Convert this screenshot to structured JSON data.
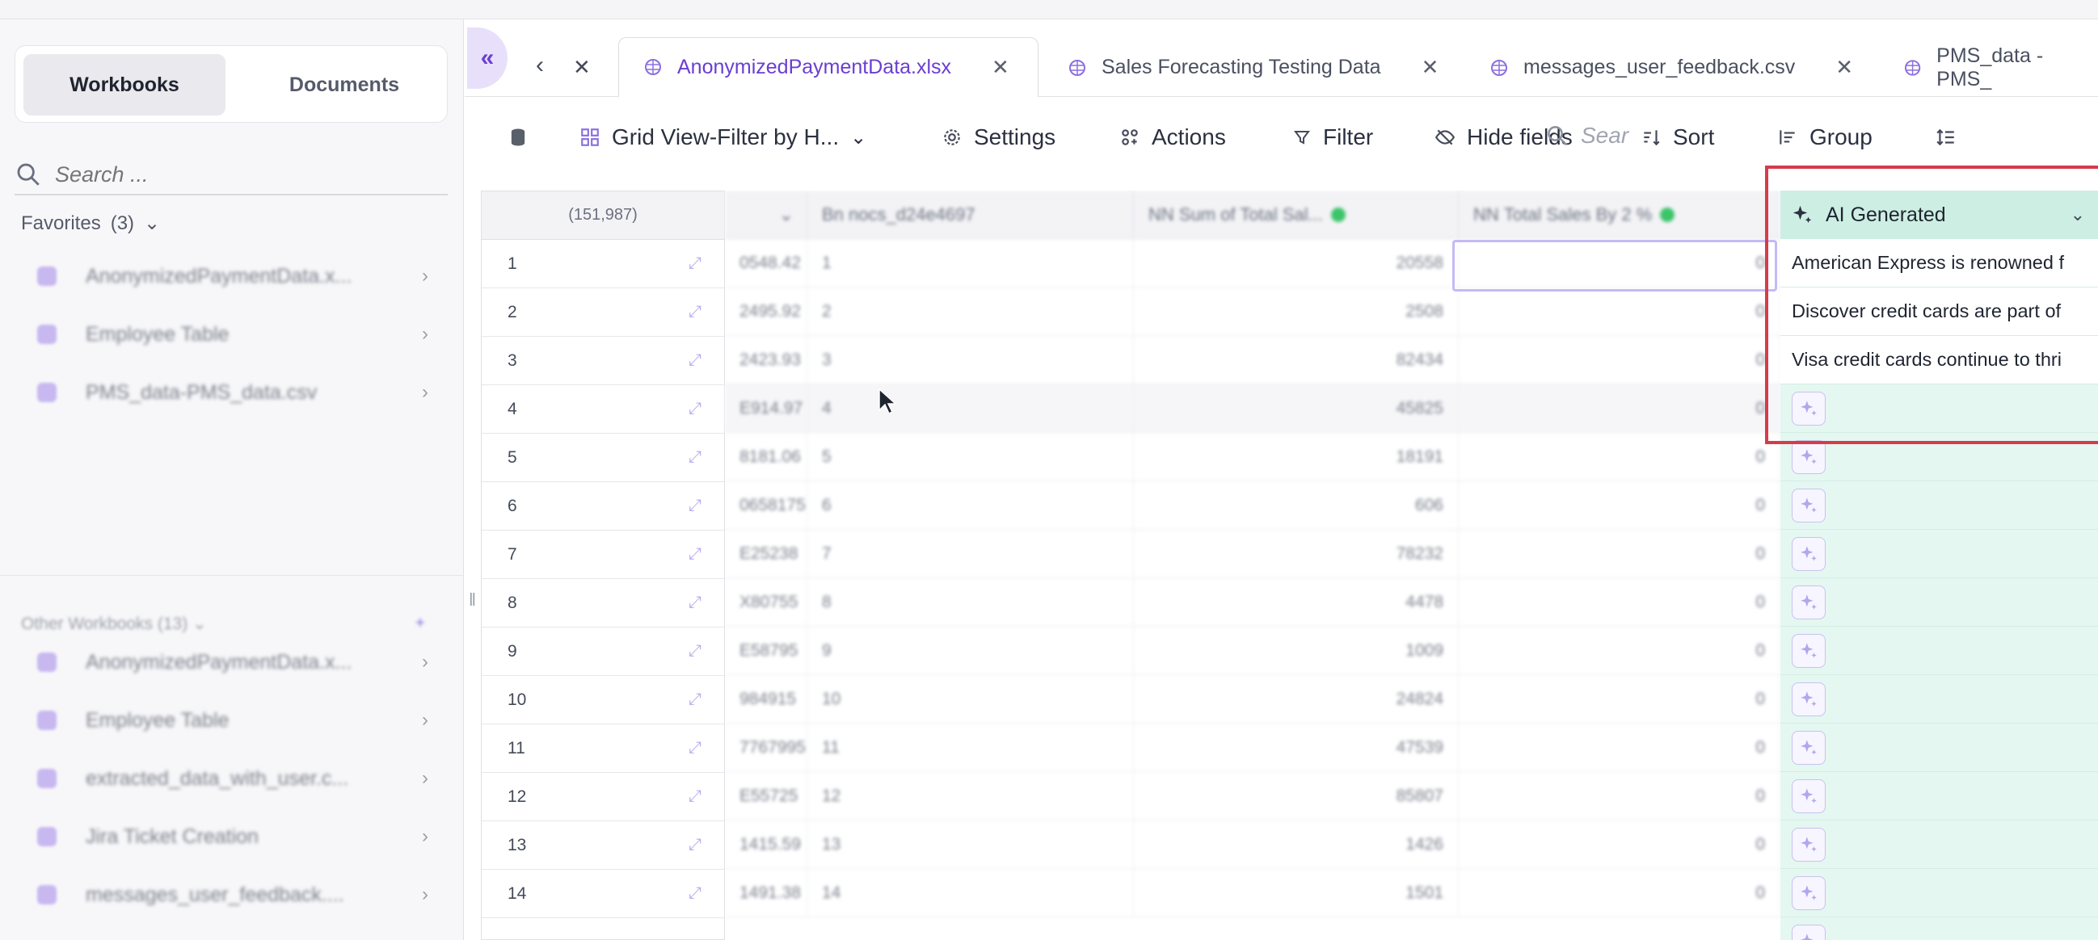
{
  "sidebar": {
    "tabs": {
      "workbooks": "Workbooks",
      "documents": "Documents"
    },
    "search_placeholder": "Search ...",
    "favorites_label": "Favorites",
    "favorites_count": "(3)",
    "favorites": [
      {
        "label": "AnonymizedPaymentData.x..."
      },
      {
        "label": "Employee Table"
      },
      {
        "label": "PMS_data-PMS_data.csv"
      }
    ],
    "other_label": "Other Workbooks",
    "other_count": "(13)",
    "others": [
      {
        "label": "AnonymizedPaymentData.x..."
      },
      {
        "label": "Employee Table"
      },
      {
        "label": "extracted_data_with_user.c..."
      },
      {
        "label": "Jira Ticket Creation"
      },
      {
        "label": "messages_user_feedback...."
      }
    ]
  },
  "tabs": [
    {
      "label": "AnonymizedPaymentData.xlsx",
      "active": true
    },
    {
      "label": "Sales Forecasting Testing Data",
      "active": false
    },
    {
      "label": "messages_user_feedback.csv",
      "active": false
    },
    {
      "label": "PMS_data - PMS_",
      "active": false
    }
  ],
  "toolbar": {
    "view_label": "Grid View-Filter by H...",
    "settings": "Settings",
    "actions": "Actions",
    "filter": "Filter",
    "hide_fields": "Hide fields",
    "sort": "Sort",
    "group": "Group",
    "search_placeholder": "Sear"
  },
  "grid": {
    "row_count": "(151,987)",
    "columns": [
      {
        "name": ""
      },
      {
        "name": "nocs_d24e4697"
      },
      {
        "name": "Sum of Total Sal..."
      },
      {
        "name": "Total Sales By 2 %"
      }
    ],
    "rows": [
      {
        "n": "1",
        "c0": "0548.42",
        "c1": "1",
        "c2": "20558",
        "c3": "0"
      },
      {
        "n": "2",
        "c0": "2495.92",
        "c1": "2",
        "c2": "2508",
        "c3": "0"
      },
      {
        "n": "3",
        "c0": "2423.93",
        "c1": "3",
        "c2": "82434",
        "c3": "0"
      },
      {
        "n": "4",
        "c0": "E914.97",
        "c1": "4",
        "c2": "45825",
        "c3": "0"
      },
      {
        "n": "5",
        "c0": "8181.06",
        "c1": "5",
        "c2": "18191",
        "c3": "0"
      },
      {
        "n": "6",
        "c0": "0658175",
        "c1": "6",
        "c2": "606",
        "c3": "0"
      },
      {
        "n": "7",
        "c0": "E25238",
        "c1": "7",
        "c2": "78232",
        "c3": "0"
      },
      {
        "n": "8",
        "c0": "X80755",
        "c1": "8",
        "c2": "4478",
        "c3": "0"
      },
      {
        "n": "9",
        "c0": "E58795",
        "c1": "9",
        "c2": "1009",
        "c3": "0"
      },
      {
        "n": "10",
        "c0": "984915",
        "c1": "10",
        "c2": "24824",
        "c3": "0"
      },
      {
        "n": "11",
        "c0": "7767995",
        "c1": "11",
        "c2": "47539",
        "c3": "0"
      },
      {
        "n": "12",
        "c0": "E55725",
        "c1": "12",
        "c2": "85807",
        "c3": "0"
      },
      {
        "n": "13",
        "c0": "1415.59",
        "c1": "13",
        "c2": "1426",
        "c3": "0"
      },
      {
        "n": "14",
        "c0": "1491.38",
        "c1": "14",
        "c2": "1501",
        "c3": "0"
      }
    ],
    "ai_column": {
      "title": "AI Generated",
      "values": [
        "American Express is renowned f",
        "Discover credit cards are part of",
        "Visa credit cards continue to thri"
      ]
    }
  },
  "colors": {
    "accent": "#6a3ed1",
    "ai_bg": "#e4f7f1",
    "highlight": "#d63b4c"
  }
}
